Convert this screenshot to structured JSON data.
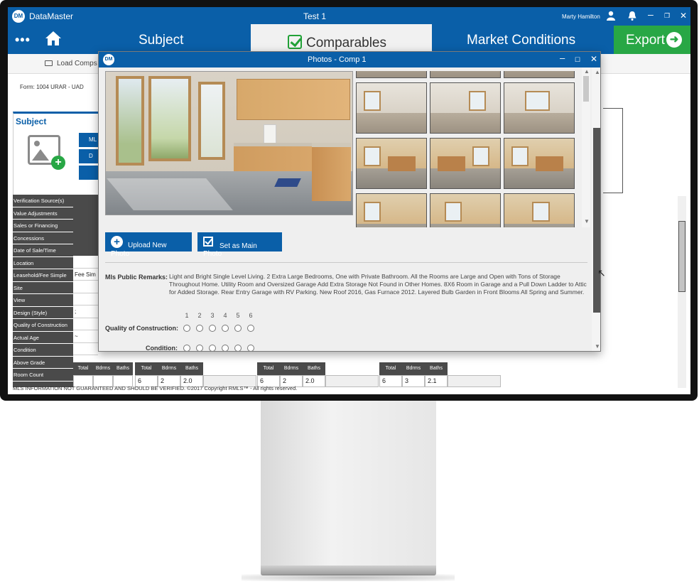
{
  "app": {
    "name": "DataMaster",
    "document_title": "Test 1",
    "user": "Marty Hamilton"
  },
  "nav": {
    "tabs": [
      {
        "label": "Subject"
      },
      {
        "label": "Comparables"
      },
      {
        "label": "Market Conditions"
      }
    ],
    "export_label": "Export"
  },
  "toolbar": {
    "load_comps": "Load Comps"
  },
  "form": {
    "label": "Form: 1004 URAR - UAD"
  },
  "subject": {
    "title": "Subject",
    "btn1": "ML",
    "btn2": "D",
    "row_labels": [
      "Verification Source(s)",
      "Value Adjustments",
      "Sales or Financing",
      "Concessions",
      "Date of Sale/Time",
      "Location",
      "Leasehold/Fee Simple",
      "Site",
      "View",
      "Design (Style)",
      "Quality of Construction",
      "Actual Age",
      "Condition",
      "Above Grade",
      "Room Count"
    ],
    "values": [
      "",
      "Fee Sim",
      "",
      "",
      ";",
      "",
      "~",
      ""
    ]
  },
  "grid": {
    "headers": [
      "Total",
      "Bdrms",
      "Baths"
    ],
    "comps": [
      {
        "total": "",
        "bdrms": "",
        "baths": ""
      },
      {
        "total": "6",
        "bdrms": "2",
        "baths": "2.0"
      },
      {
        "total": "6",
        "bdrms": "2",
        "baths": "2.0"
      },
      {
        "total": "6",
        "bdrms": "3",
        "baths": "2.1"
      }
    ]
  },
  "footer": "MLS INFORMATION NOT GUARANTEED AND SHOULD BE VERIFIED. ©2017 Copyright RMLS™ - All rights reserved.",
  "dialog": {
    "title": "Photos - Comp 1",
    "upload_label": "Upload New Photo",
    "set_main_label": "Set as Main Photo",
    "remarks_label": "Mls Public Remarks:",
    "remarks_text": "Light and Bright Single Level Living. 2 Extra Large Bedrooms, One with Private Bathroom. All the Rooms are Large and Open with Tons of Storage Throughout Home. Utility Room and Oversized Garage Add Extra Storage Not Found in Other Homes. 8X6 Room in Garage and a Pull Down Ladder to Attic for Added Storage. Rear Entry Garage with RV Parking. New Roof 2016, Gas Furnace 2012. Layered Bulb Garden in Front Blooms All Spring and Summer.",
    "rating_scale": [
      "1",
      "2",
      "3",
      "4",
      "5",
      "6"
    ],
    "quality_label": "Quality of Construction:",
    "condition_label": "Condition:"
  },
  "colors": {
    "brand_blue": "#0a5fa8",
    "export_green": "#28a745"
  },
  "icons": [
    "menu-dots-icon",
    "home-icon",
    "check-icon",
    "arrow-right-icon",
    "user-icon",
    "bell-icon",
    "minimize-icon",
    "restore-icon",
    "close-icon",
    "folder-icon",
    "image-add-icon",
    "plus-circle-icon",
    "checkbox-icon"
  ]
}
